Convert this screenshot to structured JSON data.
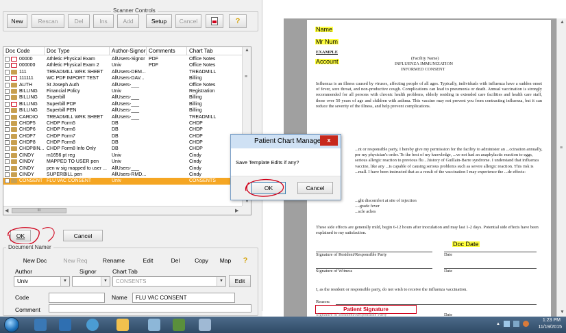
{
  "scanner_controls": {
    "title": "Scanner Controls",
    "buttons": {
      "new": "New",
      "rescan": "Rescan",
      "del": "Del",
      "ins": "Ins",
      "add": "Add",
      "setup": "Setup",
      "cancel": "Cancel"
    }
  },
  "doc_list": {
    "headers": {
      "doc_code": "Doc Code",
      "doc_type": "Doc Type",
      "author_signor": "Author-Signor",
      "comments": "Comments",
      "chart_tab": "Chart Tab"
    },
    "rows": [
      {
        "code": "00000",
        "type": "Athletic Physical Exam",
        "author": "AllUsers-Signor",
        "comments": "PDF",
        "tab": "Office Notes",
        "icon": "pdf"
      },
      {
        "code": "000000",
        "type": "Athletic Physical Exam 2",
        "author": "Univ",
        "comments": "PDF",
        "tab": "Office Notes",
        "icon": "pdf"
      },
      {
        "code": "111",
        "type": "TREADMILL WRK SHEET",
        "author": "AllUsers-DEM...",
        "comments": "",
        "tab": "TREADMILL",
        "icon": "people"
      },
      {
        "code": "111111",
        "type": "WC PDF IMPORT TEST",
        "author": "AllUsers-DAV...",
        "comments": "",
        "tab": "Billing",
        "icon": "pdf"
      },
      {
        "code": "AUTH",
        "type": "St Joseph Auth",
        "author": "AllUsers-___",
        "comments": "",
        "tab": "Office Notes",
        "icon": "people"
      },
      {
        "code": "BILLING",
        "type": "Financial Policy",
        "author": "Univ",
        "comments": "",
        "tab": "Registration",
        "icon": "people"
      },
      {
        "code": "BILLING",
        "type": "Superbill",
        "author": "AllUsers-___",
        "comments": "",
        "tab": "Billing",
        "icon": "people"
      },
      {
        "code": "BILLING",
        "type": "Superbill PDF",
        "author": "AllUsers-___",
        "comments": "",
        "tab": "Billing",
        "icon": "pdf"
      },
      {
        "code": "BILLING",
        "type": "Superbill PEN",
        "author": "AllUsers-___",
        "comments": "",
        "tab": "Billing",
        "icon": "people"
      },
      {
        "code": "CARDIO",
        "type": "TREADMILL WRK SHEET",
        "author": "AllUsers-___",
        "comments": "",
        "tab": "TREADMILL",
        "icon": "people"
      },
      {
        "code": "CHDP5",
        "type": "CHDP Form5",
        "author": "DB",
        "comments": "",
        "tab": "CHDP",
        "icon": "people"
      },
      {
        "code": "CHDP6",
        "type": "CHDP Form6",
        "author": "DB",
        "comments": "",
        "tab": "CHDP",
        "icon": "people"
      },
      {
        "code": "CHDP7",
        "type": "CHDP Form7",
        "author": "DB",
        "comments": "",
        "tab": "CHDP",
        "icon": "people"
      },
      {
        "code": "CHDP8",
        "type": "CHDP Form8",
        "author": "DB",
        "comments": "",
        "tab": "CHDP",
        "icon": "people"
      },
      {
        "code": "CHDP8IN...",
        "type": "CHDP Form8 Info Only",
        "author": "DB",
        "comments": "",
        "tab": "CHDP",
        "icon": "people"
      },
      {
        "code": "CINDY",
        "type": "m1656 pt reg",
        "author": "Univ",
        "comments": "",
        "tab": "Cindy",
        "icon": "people"
      },
      {
        "code": "CINDY",
        "type": "MAPPED TO USER pen",
        "author": "Univ",
        "comments": "",
        "tab": "Cindy",
        "icon": "people"
      },
      {
        "code": "CINDY",
        "type": "pen w sig mapped to user ...",
        "author": "AllUsers-___",
        "comments": "",
        "tab": "Cindy",
        "icon": "people"
      },
      {
        "code": "CINDY",
        "type": "SUPERBILL pen",
        "author": "AllUsers-RMD...",
        "comments": "",
        "tab": "Cindy",
        "icon": "people"
      },
      {
        "code": "CONSENT",
        "type": "FLU VAC CONSENT",
        "author": "Univ",
        "comments": "",
        "tab": "CONSENTS",
        "icon": "people",
        "selected": true
      }
    ],
    "scroll_glyph": "III"
  },
  "actions": {
    "ok": "OK",
    "cancel": "Cancel"
  },
  "document_namer": {
    "title": "Document Namer",
    "buttons": {
      "new_doc": "New Doc",
      "new_req": "New Req",
      "rename": "Rename",
      "edit": "Edit",
      "del": "Del",
      "copy": "Copy",
      "map": "Map"
    },
    "author_label": "Author",
    "signor_label": "Signor",
    "chart_tab_label": "Chart Tab",
    "author_value": "Univ",
    "signor_value": "",
    "chart_tab_value": "CONSENTS",
    "edit_button": "Edit",
    "code_label": "Code",
    "code_value": "",
    "name_label": "Name",
    "name_value": "FLU VAC CONSENT",
    "comment_label": "Comment",
    "comment_value": ""
  },
  "document": {
    "name_field": "Name",
    "mr_num_field": "Mr Num",
    "example": "EXAMPLE",
    "account_field": "Account",
    "facility": "(Facility Name)",
    "heading1": "INFLUENZA IMMUNIZATION",
    "heading2": "INFORMED CONSENT",
    "para1": "Influenza is an illness caused by viruses, affecting people of all ages. Typically, individuals with influenza have a sudden onset of fever, sore throat, and non-productive cough. Complications can lead to pneumonia or death. Annual vaccination is strongly recommended for all persons with chronic health problems, elderly residing in extended care facilities and health care staff, those over 50 years of age and children with asthma. This vaccine may not prevent you from contracting influenza, but it can reduce the severity of the illness, and help prevent complications.",
    "para2": "...nt or responsible party, I hereby give my permission for the facility to administer an ...ccination annually, per my physician's order. To the best of my knowledge, ...ve not had an anaphylactic reaction to eggs, serious allergic reaction to previous flu ...history of Guillain-Barre syndrome. I understand that influenza vaccine, like any ...is capable of causing serious problems such as severe allergic reaction. This risk is ...mall. I have been instructed that as a result of the vaccination I may experience the ...de effects:",
    "effect1": "...ght discomfort at site of injection",
    "effect2": "...-grade fever",
    "effect3": "...scle aches",
    "para3": "These side effects are generally mild, begin 6-12 hours after inoculation and may last 1-2 days. Potential side effects have been explained to my satisfaction.",
    "doc_date_field": "Doc Date",
    "sig_resident": "Signature of Resident/Responsible Party",
    "date1": "Date",
    "sig_witness": "Signature of Witness",
    "date2": "Date",
    "refuse": "I, as the resident or responsible party, do not wish to receive the influenza vaccination.",
    "reason": "Reason:",
    "patient_signature_field": "Patient Signature",
    "sig_resident2": "Signature of Resident/Responsible Party",
    "date3": "Date"
  },
  "modal": {
    "title": "Patient Chart Manager",
    "close": "x",
    "message": "Save Template Edits if any?",
    "ok": "OK",
    "cancel": "Cancel"
  },
  "taskbar": {
    "time": "1:23 PM",
    "date": "11/19/2015"
  },
  "colors": {
    "selection": "#f5a623",
    "highlight": "#ffff3f",
    "annotation_red": "#d0021b",
    "modal_title_bg": "#cfe1f4"
  }
}
